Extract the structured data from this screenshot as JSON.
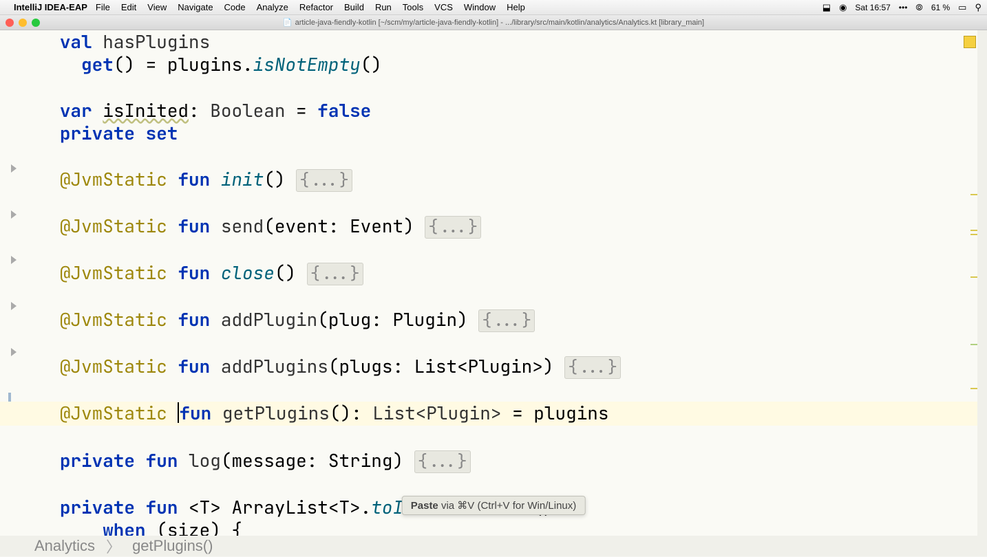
{
  "menubar": {
    "app": "IntelliJ IDEA-EAP",
    "items": [
      "File",
      "Edit",
      "View",
      "Navigate",
      "Code",
      "Analyze",
      "Refactor",
      "Build",
      "Run",
      "Tools",
      "VCS",
      "Window",
      "Help"
    ],
    "clock": "Sat 16:57",
    "battery": "61 %"
  },
  "titlebar": {
    "text": "article-java-fiendly-kotlin [~/scm/my/article-java-fiendly-kotlin] - .../library/src/main/kotlin/analytics/Analytics.kt [library_main]"
  },
  "code": {
    "line1_val": "val",
    "line1_name": "hasPlugins",
    "line2_get": "get",
    "line2_plugins": "plugins",
    "line2_isNotEmpty": "isNotEmpty",
    "line3_var": "var",
    "line3_isInited": "isInited",
    "line3_type": "Boolean",
    "line3_false": "false",
    "line4_private": "private",
    "line4_set": "set",
    "annotation": "@JvmStatic",
    "fun": "fun",
    "private": "private",
    "fn_init": "init",
    "fn_send": "send",
    "fn_send_param": "event: Event",
    "fn_close": "close",
    "fn_addPlugin": "addPlugin",
    "fn_addPlugin_param": "plug: Plugin",
    "fn_addPlugins": "addPlugins",
    "fn_addPlugins_param": "plugs: List<Plugin>",
    "fn_getPlugins": "getPlugins",
    "fn_getPlugins_ret": "List<Plugin>",
    "fn_getPlugins_body": "plugins",
    "fn_log": "log",
    "fn_log_param": "message: String",
    "fn_toImmutable": "toImmutableList",
    "fn_toImmutable_prefix": "<T> ArrayList<T>.",
    "when": "when",
    "size": "size",
    "fold": "{...}"
  },
  "hint": {
    "action": "Paste",
    "via": " via ⌘V (Ctrl+V for Win/Linux)"
  },
  "breadcrumb": {
    "class": "Analytics",
    "method": "getPlugins()"
  }
}
